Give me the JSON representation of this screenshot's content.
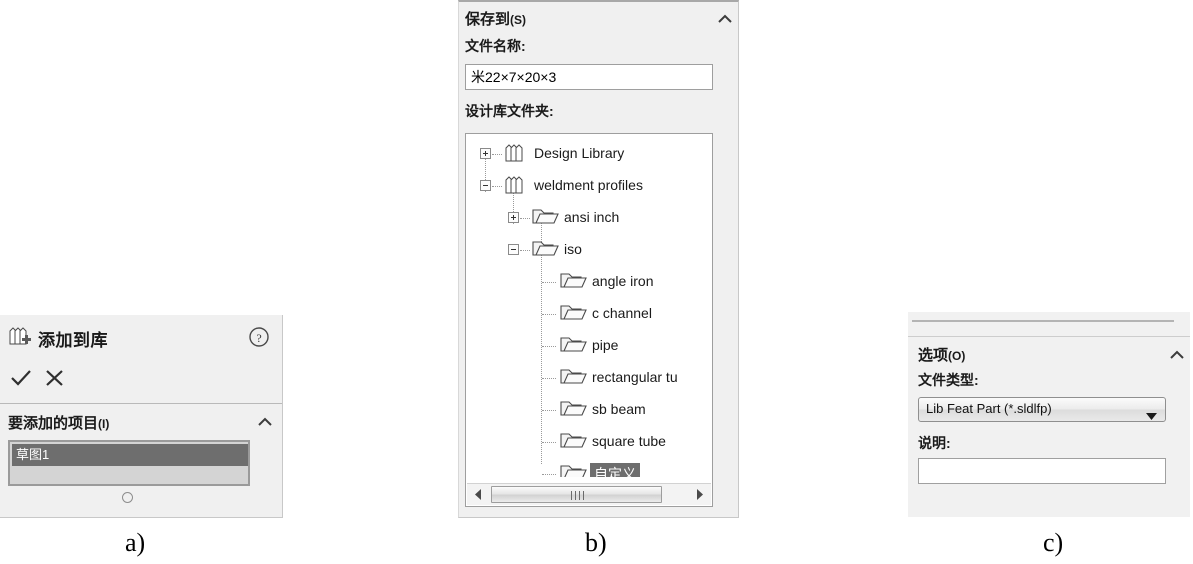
{
  "panel_a": {
    "title": "添加到库",
    "icon": "add-to-library-icon",
    "help_icon": "help-icon",
    "ok_icon": "checkmark-icon",
    "cancel_icon": "close-x-icon",
    "section": {
      "label": "要添加的项目",
      "mnemonic": "(I)",
      "collapse_icon": "chevron-up-icon",
      "items": [
        {
          "label": "草图1",
          "selected": true
        },
        {
          "label": "",
          "selected": false
        }
      ]
    },
    "caption": "a)"
  },
  "panel_b": {
    "header": {
      "label": "保存到",
      "mnemonic": "(S)",
      "collapse_icon": "chevron-up-icon"
    },
    "filename_label": "文件名称:",
    "filename_value": "米22×7×20×3",
    "designlib_label": "设计库文件夹:",
    "tree": [
      {
        "label": "Design Library",
        "icon": "library-books-icon",
        "toggle": "plus",
        "depth": 0
      },
      {
        "label": "weldment profiles",
        "icon": "library-books-icon",
        "toggle": "minus",
        "depth": 0
      },
      {
        "label": "ansi inch",
        "icon": "folder-icon",
        "toggle": "plus",
        "depth": 1
      },
      {
        "label": "iso",
        "icon": "folder-icon",
        "toggle": "minus",
        "depth": 1
      },
      {
        "label": "angle iron",
        "icon": "folder-icon",
        "toggle": "none",
        "depth": 2
      },
      {
        "label": "c channel",
        "icon": "folder-icon",
        "toggle": "none",
        "depth": 2
      },
      {
        "label": "pipe",
        "icon": "folder-icon",
        "toggle": "none",
        "depth": 2
      },
      {
        "label": "rectangular tu",
        "icon": "folder-icon",
        "toggle": "none",
        "depth": 2
      },
      {
        "label": "sb beam",
        "icon": "folder-icon",
        "toggle": "none",
        "depth": 2
      },
      {
        "label": "square tube",
        "icon": "folder-icon",
        "toggle": "none",
        "depth": 2
      },
      {
        "label": "自定义",
        "icon": "folder-icon",
        "toggle": "none",
        "depth": 2,
        "selected": true
      }
    ],
    "scrollbar": {
      "left_icon": "scroll-left-arrow-icon",
      "right_icon": "scroll-right-arrow-icon",
      "thumb_icon": "scroll-thumb-grip"
    },
    "caption": "b)"
  },
  "panel_c": {
    "header": {
      "label": "选项",
      "mnemonic": "(O)",
      "collapse_icon": "chevron-up-icon"
    },
    "filetype_label": "文件类型:",
    "filetype_value": "Lib Feat Part (*.sldlfp)",
    "filetype_arrow": "dropdown-arrow-icon",
    "description_label": "说明:",
    "description_value": "",
    "caption": "c)"
  },
  "colors": {
    "panel_bg": "#f0f0f0",
    "selection": "#6e6e6e",
    "border": "#9e9e9e",
    "text": "#1a1a1a"
  }
}
